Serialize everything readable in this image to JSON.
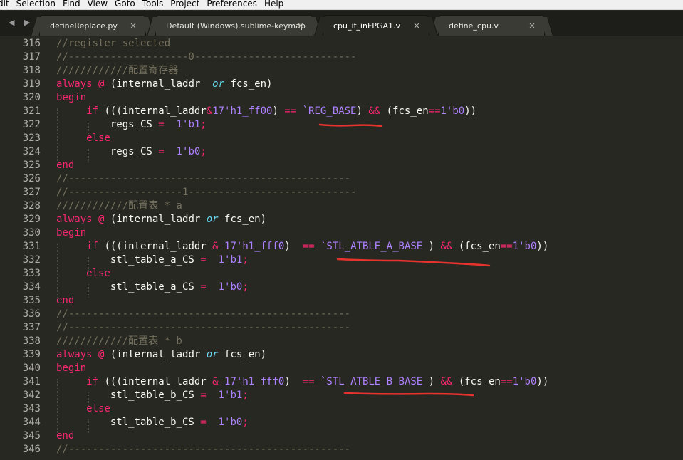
{
  "menu": [
    "dit",
    "Selection",
    "Find",
    "View",
    "Goto",
    "Tools",
    "Project",
    "Preferences",
    "Help"
  ],
  "tabs": [
    {
      "label": "defineReplace.py",
      "close": "×",
      "active": false
    },
    {
      "label": "Default (Windows).sublime-keymap",
      "close": "×",
      "active": false
    },
    {
      "label": "cpu_if_inFPGA1.v",
      "close": "×",
      "active": true
    },
    {
      "label": "define_cpu.v",
      "close": "×",
      "active": false
    }
  ],
  "nav_arrows": "◀ ▶",
  "annotation_color": "#e8322d",
  "lines": [
    {
      "num": "316",
      "segs": [
        [
          "c",
          "//register selected"
        ]
      ]
    },
    {
      "num": "317",
      "segs": [
        [
          "c",
          "//--------------------0---------------------------"
        ]
      ]
    },
    {
      "num": "318",
      "segs": [
        [
          "c",
          "////////////配置寄存器"
        ]
      ]
    },
    {
      "num": "319",
      "segs": [
        [
          "k",
          "always"
        ],
        [
          "",
          " "
        ],
        [
          "k",
          "@"
        ],
        [
          "",
          " (internal_laddr  "
        ],
        [
          "t",
          "or"
        ],
        [
          "",
          " fcs_en)"
        ]
      ]
    },
    {
      "num": "320",
      "segs": [
        [
          "k",
          "begin"
        ]
      ]
    },
    {
      "num": "321",
      "segs": [
        [
          "",
          "     "
        ],
        [
          "k",
          "if"
        ],
        [
          "",
          " (((internal_laddr"
        ],
        [
          "k",
          "&"
        ],
        [
          "n",
          "17'h1_ff00"
        ],
        [
          "",
          ") "
        ],
        [
          "k",
          "=="
        ],
        [
          "",
          " "
        ],
        [
          "n",
          "`REG_BASE"
        ],
        [
          "",
          ") "
        ],
        [
          "k",
          "&&"
        ],
        [
          "",
          " (fcs_en"
        ],
        [
          "k",
          "=="
        ],
        [
          "n",
          "1'b0"
        ],
        [
          "",
          "))"
        ]
      ]
    },
    {
      "num": "322",
      "segs": [
        [
          "",
          "         regs_CS "
        ],
        [
          "k",
          "="
        ],
        [
          "",
          "  "
        ],
        [
          "n",
          "1'b1"
        ],
        [
          "k",
          ";"
        ]
      ]
    },
    {
      "num": "323",
      "segs": [
        [
          "",
          "     "
        ],
        [
          "k",
          "else"
        ]
      ]
    },
    {
      "num": "324",
      "segs": [
        [
          "",
          "         regs_CS "
        ],
        [
          "k",
          "="
        ],
        [
          "",
          "  "
        ],
        [
          "n",
          "1'b0"
        ],
        [
          "k",
          ";"
        ]
      ]
    },
    {
      "num": "325",
      "segs": [
        [
          "k",
          "end"
        ]
      ]
    },
    {
      "num": "326",
      "segs": [
        [
          "c",
          "//-----------------------------------------------"
        ]
      ]
    },
    {
      "num": "327",
      "segs": [
        [
          "c",
          "//-------------------1----------------------------"
        ]
      ]
    },
    {
      "num": "328",
      "segs": [
        [
          "c",
          "////////////配置表 * a"
        ]
      ]
    },
    {
      "num": "329",
      "segs": [
        [
          "k",
          "always"
        ],
        [
          "",
          " "
        ],
        [
          "k",
          "@"
        ],
        [
          "",
          " (internal_laddr "
        ],
        [
          "t",
          "or"
        ],
        [
          "",
          " fcs_en)"
        ]
      ]
    },
    {
      "num": "330",
      "segs": [
        [
          "k",
          "begin"
        ]
      ]
    },
    {
      "num": "331",
      "segs": [
        [
          "",
          "     "
        ],
        [
          "k",
          "if"
        ],
        [
          "",
          " (((internal_laddr "
        ],
        [
          "k",
          "&"
        ],
        [
          "",
          " "
        ],
        [
          "n",
          "17'h1_fff0"
        ],
        [
          "",
          ")  "
        ],
        [
          "k",
          "=="
        ],
        [
          "",
          " "
        ],
        [
          "n",
          "`STL_ATBLE_A_BASE"
        ],
        [
          "",
          " ) "
        ],
        [
          "k",
          "&&"
        ],
        [
          "",
          " (fcs_en"
        ],
        [
          "k",
          "=="
        ],
        [
          "n",
          "1'b0"
        ],
        [
          "",
          "))"
        ]
      ]
    },
    {
      "num": "332",
      "segs": [
        [
          "",
          "         stl_table_a_CS "
        ],
        [
          "k",
          "="
        ],
        [
          "",
          "  "
        ],
        [
          "n",
          "1'b1"
        ],
        [
          "k",
          ";"
        ]
      ]
    },
    {
      "num": "333",
      "segs": [
        [
          "",
          "     "
        ],
        [
          "k",
          "else"
        ]
      ]
    },
    {
      "num": "334",
      "segs": [
        [
          "",
          "         stl_table_a_CS "
        ],
        [
          "k",
          "="
        ],
        [
          "",
          "  "
        ],
        [
          "n",
          "1'b0"
        ],
        [
          "k",
          ";"
        ]
      ]
    },
    {
      "num": "335",
      "segs": [
        [
          "k",
          "end"
        ]
      ]
    },
    {
      "num": "336",
      "segs": [
        [
          "c",
          "//-----------------------------------------------"
        ]
      ]
    },
    {
      "num": "337",
      "segs": [
        [
          "c",
          "//-----------------------------------------------"
        ]
      ]
    },
    {
      "num": "338",
      "segs": [
        [
          "c",
          "////////////配置表 * b"
        ]
      ]
    },
    {
      "num": "339",
      "segs": [
        [
          "k",
          "always"
        ],
        [
          "",
          " "
        ],
        [
          "k",
          "@"
        ],
        [
          "",
          " (internal_laddr "
        ],
        [
          "t",
          "or"
        ],
        [
          "",
          " fcs_en)"
        ]
      ]
    },
    {
      "num": "340",
      "segs": [
        [
          "k",
          "begin"
        ]
      ]
    },
    {
      "num": "341",
      "segs": [
        [
          "",
          "     "
        ],
        [
          "k",
          "if"
        ],
        [
          "",
          " (((internal_laddr "
        ],
        [
          "k",
          "&"
        ],
        [
          "",
          " "
        ],
        [
          "n",
          "17'h1_fff0"
        ],
        [
          "",
          ")  "
        ],
        [
          "k",
          "=="
        ],
        [
          "",
          " "
        ],
        [
          "n",
          "`STL_ATBLE_B_BASE"
        ],
        [
          "",
          " ) "
        ],
        [
          "k",
          "&&"
        ],
        [
          "",
          " (fcs_en"
        ],
        [
          "k",
          "=="
        ],
        [
          "n",
          "1'b0"
        ],
        [
          "",
          "))"
        ]
      ]
    },
    {
      "num": "342",
      "segs": [
        [
          "",
          "         stl_table_b_CS "
        ],
        [
          "k",
          "="
        ],
        [
          "",
          "  "
        ],
        [
          "n",
          "1'b1"
        ],
        [
          "k",
          ";"
        ]
      ]
    },
    {
      "num": "343",
      "segs": [
        [
          "",
          "     "
        ],
        [
          "k",
          "else"
        ]
      ]
    },
    {
      "num": "344",
      "segs": [
        [
          "",
          "         stl_table_b_CS "
        ],
        [
          "k",
          "="
        ],
        [
          "",
          "  "
        ],
        [
          "n",
          "1'b0"
        ],
        [
          "k",
          ";"
        ]
      ]
    },
    {
      "num": "345",
      "segs": [
        [
          "k",
          "end"
        ]
      ]
    },
    {
      "num": "346",
      "segs": [
        [
          "c",
          "//-----------------------------------------------"
        ]
      ]
    }
  ]
}
